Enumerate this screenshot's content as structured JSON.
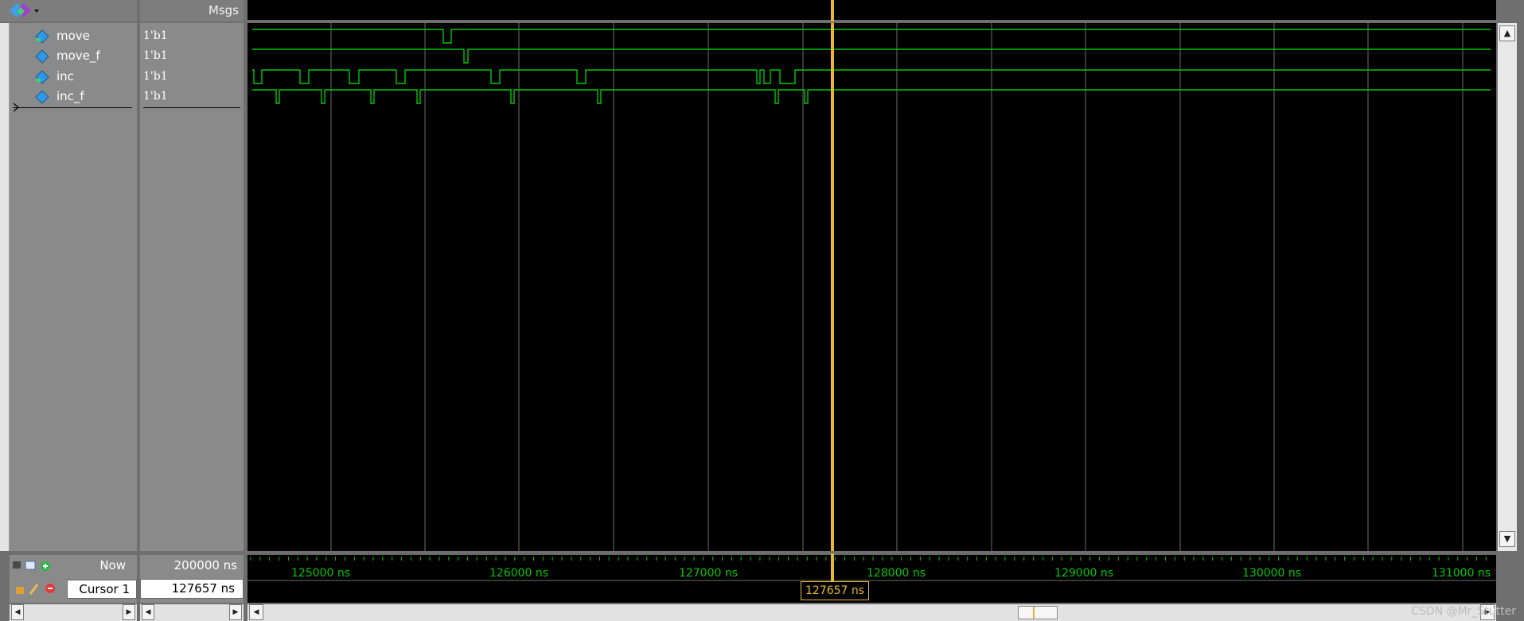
{
  "header": {
    "msgs_label": "Msgs"
  },
  "signals": [
    {
      "name": "move",
      "value": "1'b1"
    },
    {
      "name": "move_f",
      "value": "1'b1"
    },
    {
      "name": "inc",
      "value": "1'b1"
    },
    {
      "name": "inc_f",
      "value": "1'b1"
    }
  ],
  "status": {
    "now_label": "Now",
    "now_value": "200000 ns",
    "cursor_label": "Cursor 1",
    "cursor_value": "127657 ns",
    "cursor_readout": "127657 ns"
  },
  "timeline": {
    "tick_labels": [
      "125000 ns",
      "126000 ns",
      "127000 ns",
      "128000 ns",
      "129000 ns",
      "130000 ns",
      "131000 ns"
    ]
  },
  "colors": {
    "waveform": "#00c800",
    "cursor": "#e8b830",
    "gridline": "#6e6e6e"
  },
  "watermark": "CSDN @Mr_Stutter"
}
